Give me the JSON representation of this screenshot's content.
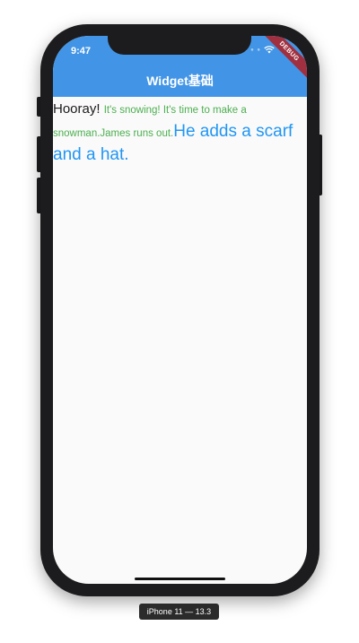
{
  "device": {
    "label": "iPhone 11 — 13.3"
  },
  "status_bar": {
    "time": "9:47",
    "signal_icon": "signal-dots-icon",
    "wifi_icon": "wifi-icon"
  },
  "app_bar": {
    "title": "Widget基础",
    "color": "#4295e6"
  },
  "debug_banner": {
    "label": "DEBUG",
    "color": "#a0303f"
  },
  "content": {
    "spans": [
      {
        "text": "Hooray! ",
        "color": "#1a1a1a"
      },
      {
        "text": "It's snowing! It's time to make a snowman.James runs out.",
        "color": "#4caf50"
      },
      {
        "text": "He adds a scarf and a hat.",
        "color": "#2196f3"
      }
    ]
  }
}
